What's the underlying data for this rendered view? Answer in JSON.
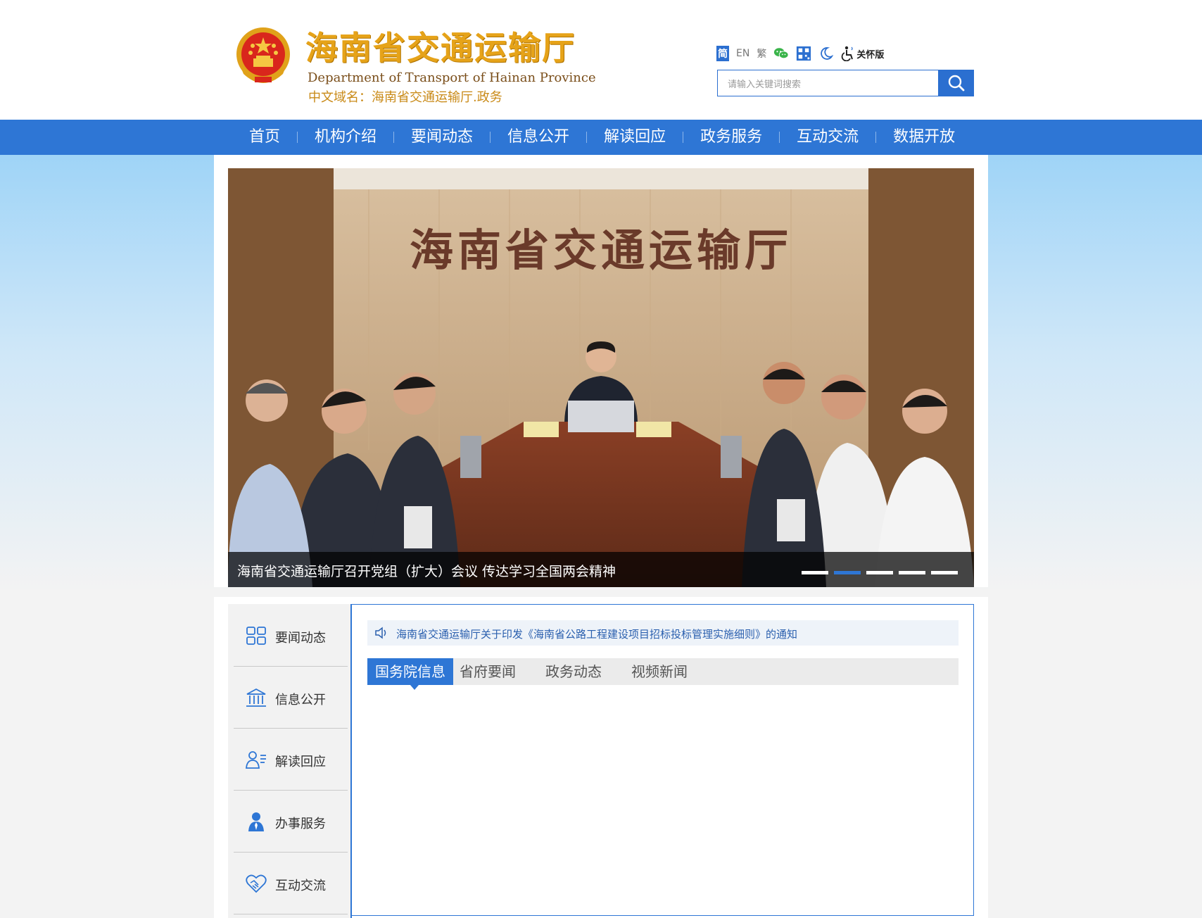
{
  "header": {
    "title_cn": "海南省交通运输厅",
    "title_en": "Department of Transport of Hainan Province",
    "domain": "中文域名：海南省交通运输厅.政务"
  },
  "tools": {
    "simplified": "简",
    "english": "EN",
    "traditional": "繁",
    "care_mode": "关怀版",
    "icons": [
      "wechat-icon",
      "mini-program-icon",
      "night-mode-icon",
      "accessibility-icon"
    ]
  },
  "search": {
    "placeholder": "请输入关键词搜索"
  },
  "nav": {
    "items": [
      "首页",
      "机构介绍",
      "要闻动态",
      "信息公开",
      "解读回应",
      "政务服务",
      "互动交流",
      "数据开放"
    ]
  },
  "banner": {
    "sign_text": "海南省交通运输厅",
    "caption": "海南省交通运输厅召开党组（扩大）会议 传达学习全国两会精神",
    "slide_count": 5,
    "active_slide": 2
  },
  "side": {
    "items": [
      {
        "label": "要闻动态",
        "icon": "grid-icon"
      },
      {
        "label": "信息公开",
        "icon": "building-icon"
      },
      {
        "label": "解读回应",
        "icon": "user-list-icon"
      },
      {
        "label": "办事服务",
        "icon": "person-icon"
      },
      {
        "label": "互动交流",
        "icon": "handshake-icon"
      }
    ]
  },
  "notice": {
    "text": "海南省交通运输厅关于印发《海南省公路工程建设项目招标投标管理实施细则》的通知"
  },
  "tabs": {
    "items": [
      "国务院信息",
      "省府要闻",
      "政务动态",
      "视频新闻"
    ],
    "active": 0
  },
  "colors": {
    "primary": "#2e76d5",
    "brand_gold": "#e6a319",
    "brand_brown": "#7a4e1a"
  }
}
